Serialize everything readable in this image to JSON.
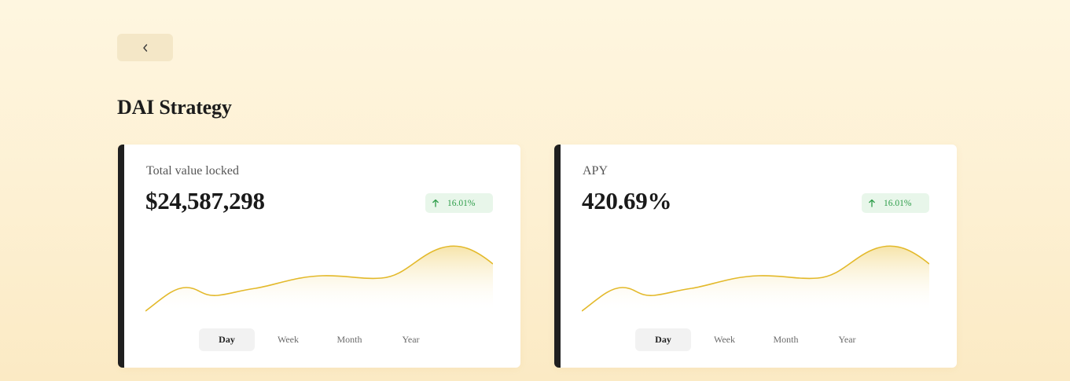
{
  "nav": {
    "back_icon": "chevron-left-icon"
  },
  "page": {
    "title": "DAI Strategy"
  },
  "colors": {
    "accent": "#e3b92a",
    "positive": "#2e9d4a",
    "positive_bg": "#e8f6ea",
    "card_border": "#1f1f1f"
  },
  "cards": [
    {
      "label": "Total value locked",
      "value": "$24,587,298",
      "change": "16.01%",
      "change_icon": "arrow-up-icon",
      "ranges": [
        "Day",
        "Week",
        "Month",
        "Year"
      ],
      "active_range": "Day"
    },
    {
      "label": "APY",
      "value": "420.69%",
      "change": "16.01%",
      "change_icon": "arrow-up-icon",
      "ranges": [
        "Day",
        "Week",
        "Month",
        "Year"
      ],
      "active_range": "Day"
    }
  ]
}
